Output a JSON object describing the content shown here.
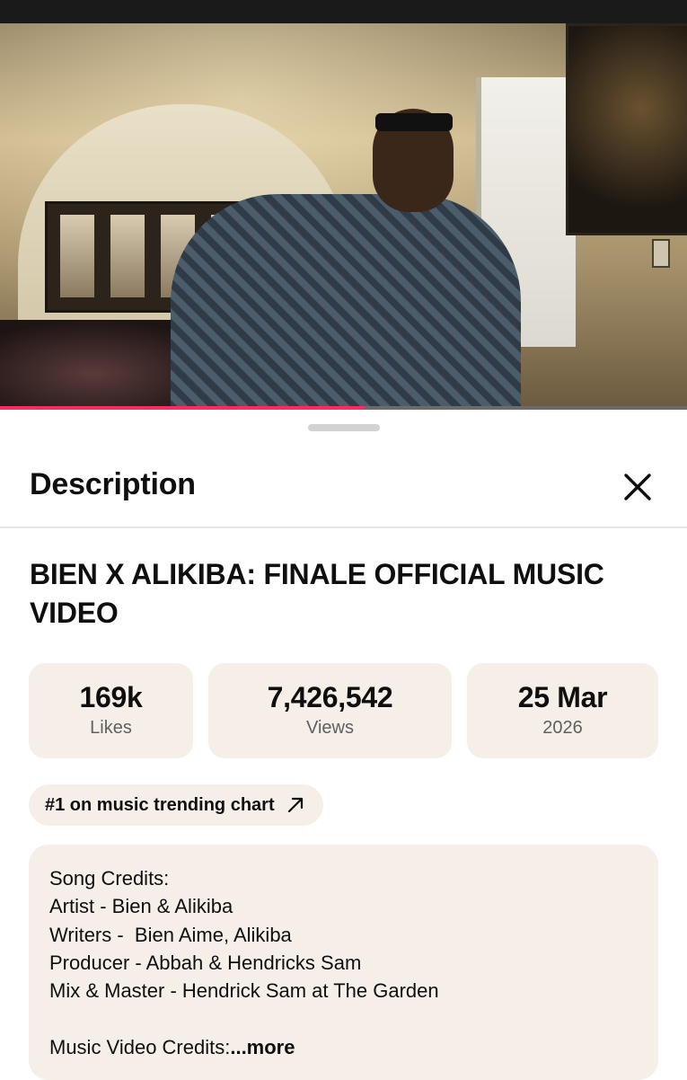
{
  "video": {
    "progress_fraction": 0.53
  },
  "sheet": {
    "title": "Description",
    "close_icon": "close-icon"
  },
  "video_title": "BIEN X ALIKIBA: FINALE OFFICIAL MUSIC VIDEO",
  "stats": [
    {
      "value": "169k",
      "label": "Likes"
    },
    {
      "value": "7,426,542",
      "label": "Views"
    },
    {
      "value": "25 Mar",
      "label": "2026"
    }
  ],
  "trending": {
    "label": "#1 on music trending chart",
    "icon": "arrow-up-right-icon"
  },
  "description": {
    "lines": [
      "Song Credits:",
      "Artist - Bien & Alikiba",
      "Writers -  Bien Aime, Alikiba",
      "Producer - Abbah & Hendricks Sam",
      "Mix & Master - Hendrick Sam at The Garden",
      "",
      "Music Video Credits:"
    ],
    "more_label": "...more"
  },
  "colors": {
    "accent": "#ff2a5f",
    "card_bg": "#f5efe8"
  }
}
